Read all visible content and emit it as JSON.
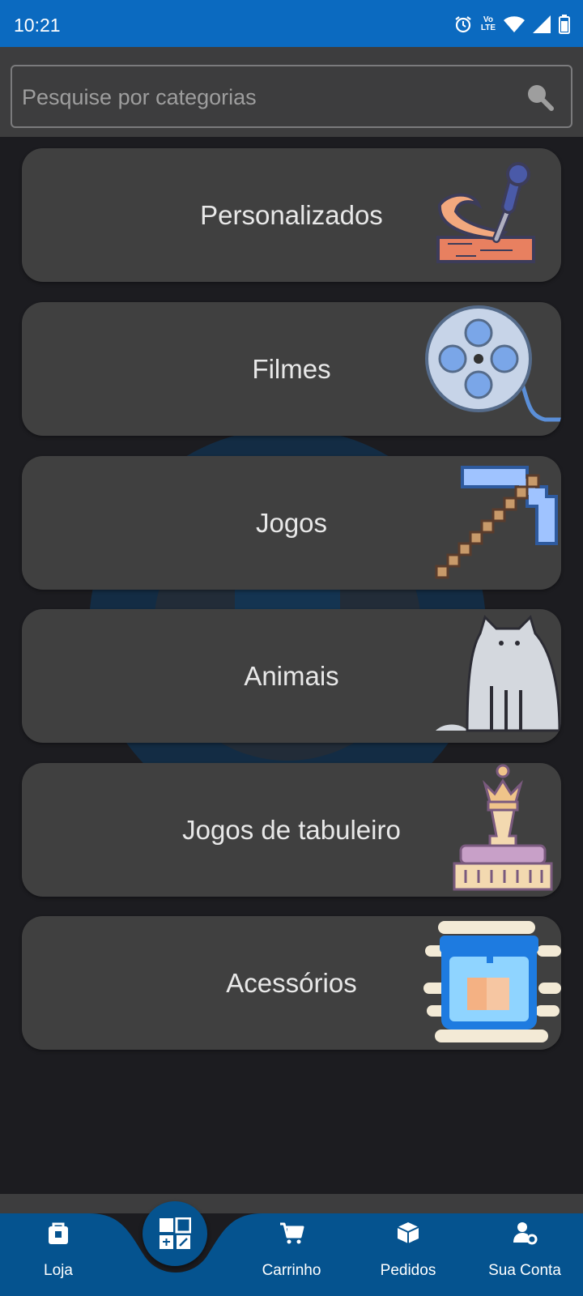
{
  "status_bar": {
    "time": "10:21",
    "network_top": "Vo",
    "network_bottom": "LTE"
  },
  "search": {
    "placeholder": "Pesquise por categorias"
  },
  "categories": [
    {
      "label": "Personalizados",
      "icon": "woodcarving-icon"
    },
    {
      "label": "Filmes",
      "icon": "film-reel-icon"
    },
    {
      "label": "Jogos",
      "icon": "pixel-pickaxe-icon"
    },
    {
      "label": "Animais",
      "icon": "cat-icon"
    },
    {
      "label": "Jogos de tabuleiro",
      "icon": "chess-king-icon"
    },
    {
      "label": "Acessórios",
      "icon": "3d-printer-icon"
    }
  ],
  "bottom_nav": {
    "items": [
      {
        "label": "Loja",
        "icon": "store-bag-icon"
      },
      {
        "label": "Carrinho",
        "icon": "cart-icon"
      },
      {
        "label": "Pedidos",
        "icon": "package-icon"
      },
      {
        "label": "Sua Conta",
        "icon": "account-settings-icon"
      }
    ],
    "active_icon": "categories-grid-icon"
  },
  "colors": {
    "status_bar": "#0b6ac0",
    "background": "#1c1c20",
    "card": "#404040",
    "nav_bar": "#05538f",
    "search_bar": "#3d3d3e"
  }
}
